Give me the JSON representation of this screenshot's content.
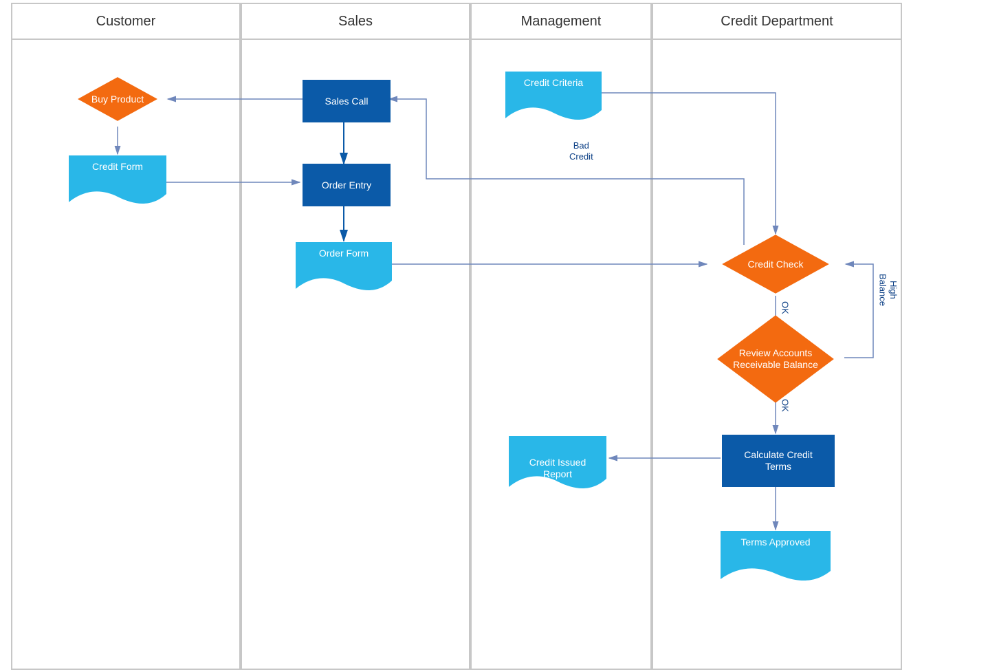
{
  "lanes": {
    "customer": "Customer",
    "sales": "Sales",
    "management": "Management",
    "credit_dept": "Credit Department"
  },
  "nodes": {
    "buy_product": "Buy Product",
    "credit_form": "Credit Form",
    "sales_call": "Sales Call",
    "order_entry": "Order Entry",
    "order_form": "Order Form",
    "credit_criteria": "Credit Criteria",
    "credit_check": "Credit Check",
    "review_ar_balance": "Review Accounts Receivable Balance",
    "calculate_credit_terms": "Calculate Credit Terms",
    "credit_issued_report_l1": "Credit Issued",
    "credit_issued_report_l2": "Report",
    "terms_approved": "Terms Approved"
  },
  "edges": {
    "bad_credit_l1": "Bad",
    "bad_credit_l2": "Credit",
    "ok1": "OK",
    "ok2": "OK",
    "high_balance_l1": "High",
    "high_balance_l2": "Balance"
  }
}
